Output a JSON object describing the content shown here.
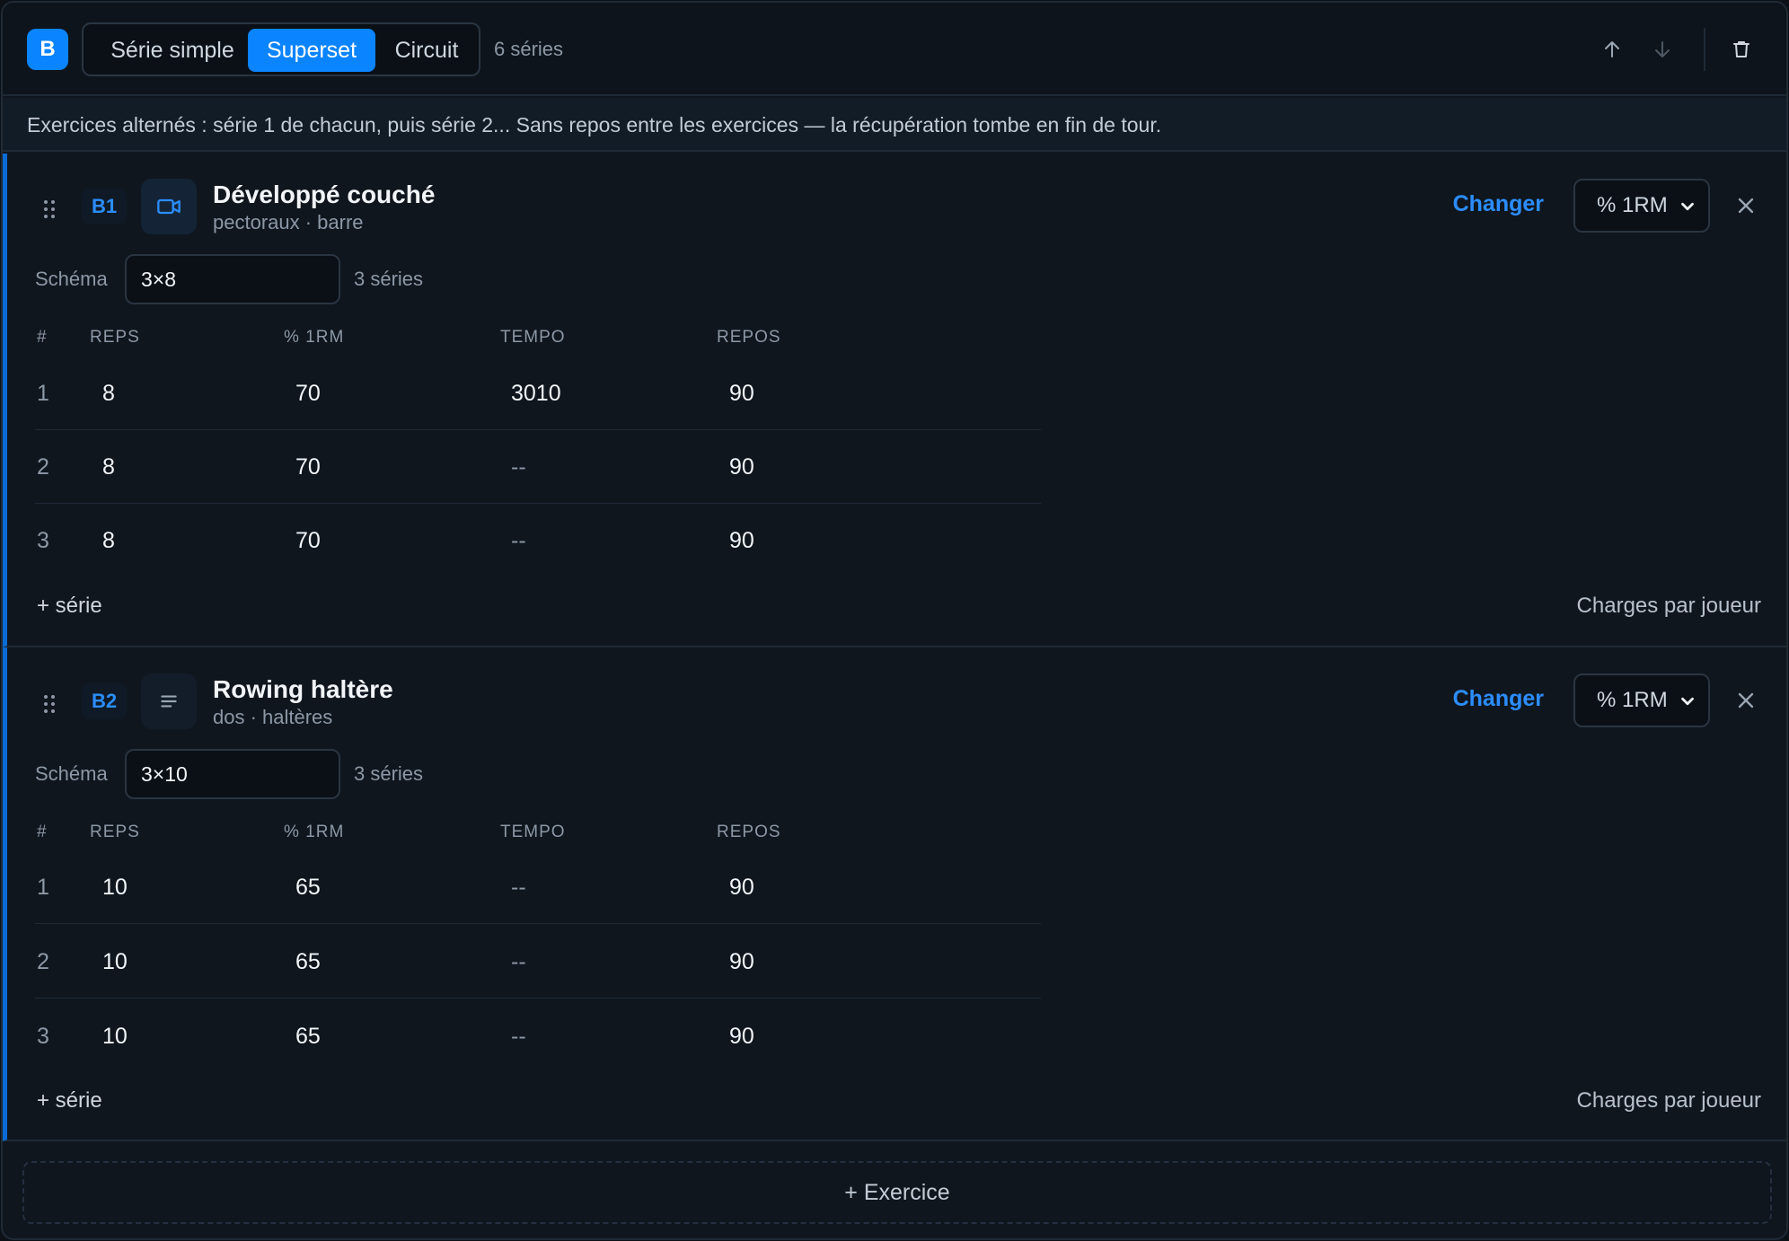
{
  "block": {
    "letter": "B",
    "modes": [
      "Série simple",
      "Superset",
      "Circuit"
    ],
    "active_mode": "Superset",
    "series_count": "6 séries",
    "info": "Exercices alternés : série 1 de chacun, puis série 2... Sans repos entre les exercices — la récupération tombe en fin de tour."
  },
  "columns": [
    "#",
    "REPS",
    "% 1RM",
    "TEMPO",
    "REPOS"
  ],
  "exercises": [
    {
      "code": "B1",
      "icon": "video-camera-icon",
      "name": "Développé couché",
      "sub": "pectoraux · barre",
      "change_label": "Changer",
      "unit": "% 1RM",
      "schema_label": "Schéma",
      "schema_value": "3×8",
      "schema_count": "3 séries",
      "rows": [
        {
          "idx": "1",
          "reps": "8",
          "pct": "70",
          "tempo": "3010",
          "rest": "90"
        },
        {
          "idx": "2",
          "reps": "8",
          "pct": "70",
          "tempo": "--",
          "rest": "90"
        },
        {
          "idx": "3",
          "reps": "8",
          "pct": "70",
          "tempo": "--",
          "rest": "90"
        }
      ],
      "add_series": "+ série",
      "charges": "Charges par joueur"
    },
    {
      "code": "B2",
      "icon": "text-lines-icon",
      "name": "Rowing haltère",
      "sub": "dos · haltères",
      "change_label": "Changer",
      "unit": "% 1RM",
      "schema_label": "Schéma",
      "schema_value": "3×10",
      "schema_count": "3 séries",
      "rows": [
        {
          "idx": "1",
          "reps": "10",
          "pct": "65",
          "tempo": "--",
          "rest": "90"
        },
        {
          "idx": "2",
          "reps": "10",
          "pct": "65",
          "tempo": "--",
          "rest": "90"
        },
        {
          "idx": "3",
          "reps": "10",
          "pct": "65",
          "tempo": "--",
          "rest": "90"
        }
      ],
      "add_series": "+ série",
      "charges": "Charges par joueur"
    }
  ],
  "add_exercise": "+ Exercice",
  "colors": {
    "accent": "#0b84ff",
    "background": "#0f161e",
    "border": "#1f2a36"
  }
}
